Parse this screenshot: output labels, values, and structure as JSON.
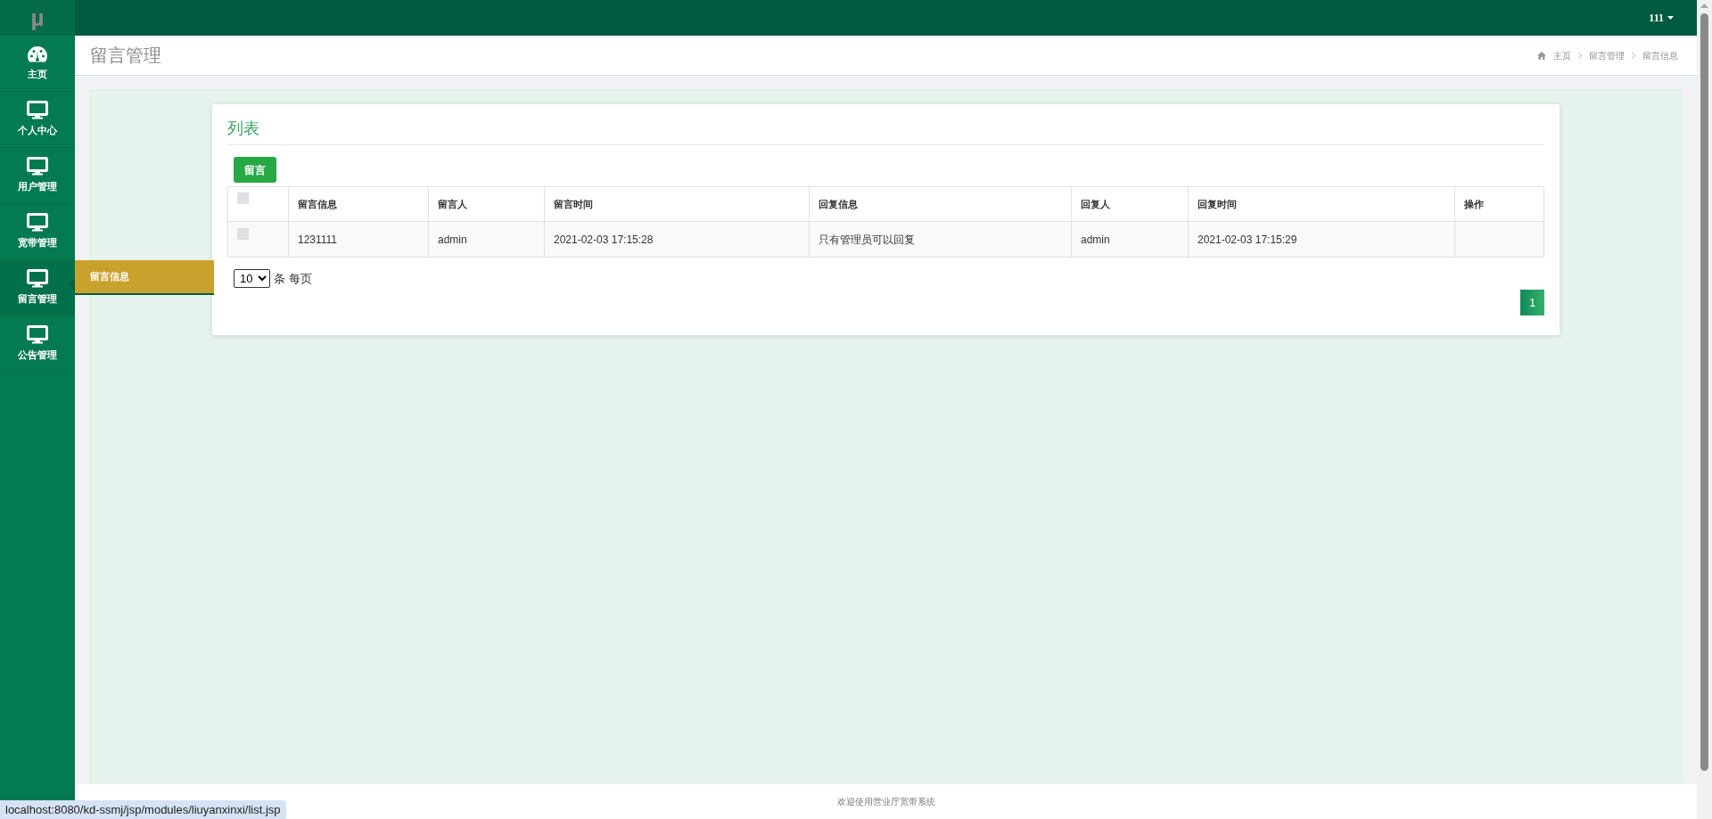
{
  "logo": "µ",
  "user_menu": {
    "label": "111"
  },
  "sidebar": {
    "items": [
      {
        "label": "主页",
        "kind": "dashboard",
        "selected": false
      },
      {
        "label": "个人中心",
        "kind": "monitor",
        "selected": false
      },
      {
        "label": "用户管理",
        "kind": "monitor",
        "selected": false
      },
      {
        "label": "宽带管理",
        "kind": "monitor",
        "selected": false
      },
      {
        "label": "留言管理",
        "kind": "monitor",
        "selected": true
      },
      {
        "label": "公告管理",
        "kind": "monitor",
        "selected": false
      }
    ]
  },
  "submenu": {
    "items": [
      {
        "label": "留言信息",
        "selected": true
      }
    ]
  },
  "page_title": "留言管理",
  "breadcrumb": [
    "主页",
    "留言管理",
    "留言信息"
  ],
  "card": {
    "title": "列表",
    "add_button": "留言",
    "table": {
      "header_checked": false,
      "columns": [
        "留言信息",
        "留言人",
        "留言时间",
        "回复信息",
        "回复人",
        "回复时间",
        "操作"
      ],
      "rows": [
        {
          "checked": false,
          "cells": [
            "1231111",
            "admin",
            "2021-02-03 17:15:28",
            "只有管理员可以回复",
            "admin",
            "2021-02-03 17:15:29",
            ""
          ]
        }
      ]
    },
    "page_size": "10",
    "page_size_label": "条 每页",
    "pages": [
      {
        "label": "1",
        "selected": true
      }
    ]
  },
  "footer": "欢迎使用营业厅宽带系统",
  "status_url": "localhost:8080/kd-ssmj/jsp/modules/liuyanxinxi/list.jsp"
}
